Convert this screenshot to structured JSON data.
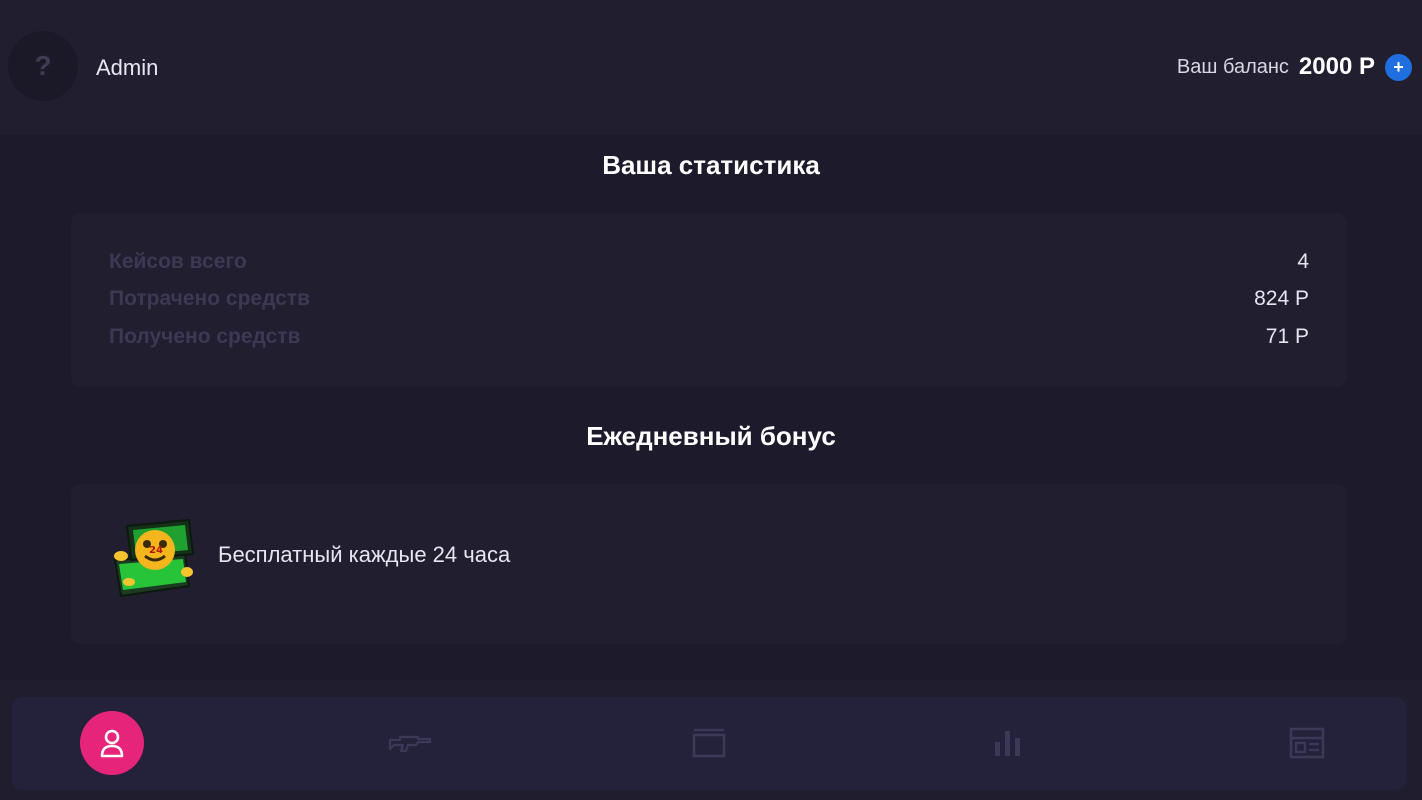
{
  "header": {
    "avatar_icon": "question-mark-icon",
    "avatar_glyph": "?",
    "username": "Admin",
    "balance_label": "Ваш баланс",
    "balance_value": "2000 Р",
    "add_funds_glyph": "+"
  },
  "stats": {
    "title": "Ваша статистика",
    "rows": [
      {
        "label": "Кейсов всего",
        "value": "4"
      },
      {
        "label": "Потрачено средств",
        "value": "824 Р"
      },
      {
        "label": "Получено средств",
        "value": "71 Р"
      }
    ]
  },
  "bonus": {
    "title": "Ежедневный бонус",
    "text": "Бесплатный каждые 24 часа",
    "icon": "bonus-case-icon"
  },
  "nav": {
    "items": [
      {
        "icon": "user-icon",
        "active": true
      },
      {
        "icon": "rifle-icon",
        "active": false
      },
      {
        "icon": "case-icon",
        "active": false
      },
      {
        "icon": "bar-chart-icon",
        "active": false
      },
      {
        "icon": "panel-icon",
        "active": false
      }
    ]
  },
  "colors": {
    "background": "#1c1a2b",
    "panel": "#211e30",
    "accent_pink": "#e5247a",
    "accent_blue": "#1f6fe0",
    "muted_label": "#3d3854"
  }
}
